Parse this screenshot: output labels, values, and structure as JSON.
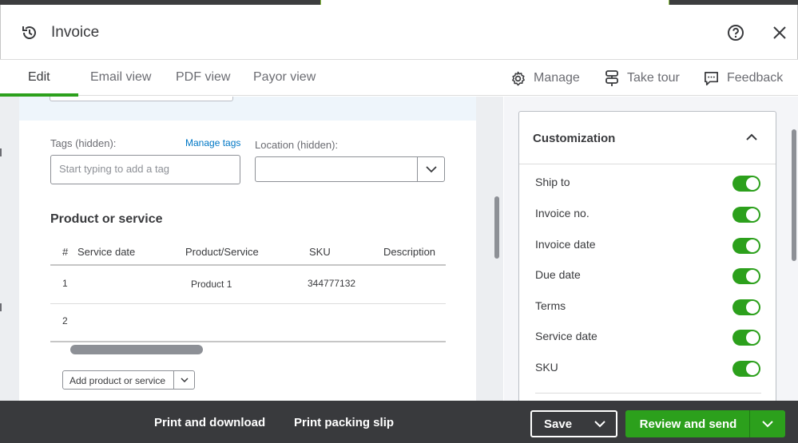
{
  "header": {
    "title": "Invoice",
    "icons": {
      "history": "history-icon",
      "help": "help-icon",
      "close": "close-icon"
    }
  },
  "tabs": [
    {
      "label": "Edit",
      "active": true
    },
    {
      "label": "Email view",
      "active": false
    },
    {
      "label": "PDF view",
      "active": false
    },
    {
      "label": "Payor view",
      "active": false
    }
  ],
  "toolbar": {
    "manage": "Manage",
    "take_tour": "Take tour",
    "feedback": "Feedback"
  },
  "form": {
    "tags_label": "Tags (hidden):",
    "manage_tags": "Manage tags",
    "tags_placeholder": "Start typing to add a tag",
    "location_label": "Location (hidden):",
    "location_value": "",
    "section_title": "Product or service",
    "columns": [
      "#",
      "Service date",
      "Product/Service",
      "SKU",
      "Description"
    ],
    "rows": [
      {
        "num": "1",
        "service_date": "",
        "product": "Product 1",
        "sku": "344777132",
        "description": ""
      },
      {
        "num": "2",
        "service_date": "",
        "product": "",
        "sku": "",
        "description": ""
      }
    ],
    "add_button": "Add product or service"
  },
  "customization": {
    "title": "Customization",
    "items": [
      {
        "label": "Ship to",
        "enabled": true
      },
      {
        "label": "Invoice no.",
        "enabled": true
      },
      {
        "label": "Invoice date",
        "enabled": true
      },
      {
        "label": "Due date",
        "enabled": true
      },
      {
        "label": "Terms",
        "enabled": true
      },
      {
        "label": "Service date",
        "enabled": true
      },
      {
        "label": "SKU",
        "enabled": true
      }
    ]
  },
  "footer": {
    "print_download": "Print and download",
    "print_slip": "Print packing slip",
    "save": "Save",
    "review_send": "Review and send"
  },
  "colors": {
    "accent_green": "#2ca01c",
    "footer_bg": "#393a3d",
    "link_blue": "#0077c5"
  }
}
